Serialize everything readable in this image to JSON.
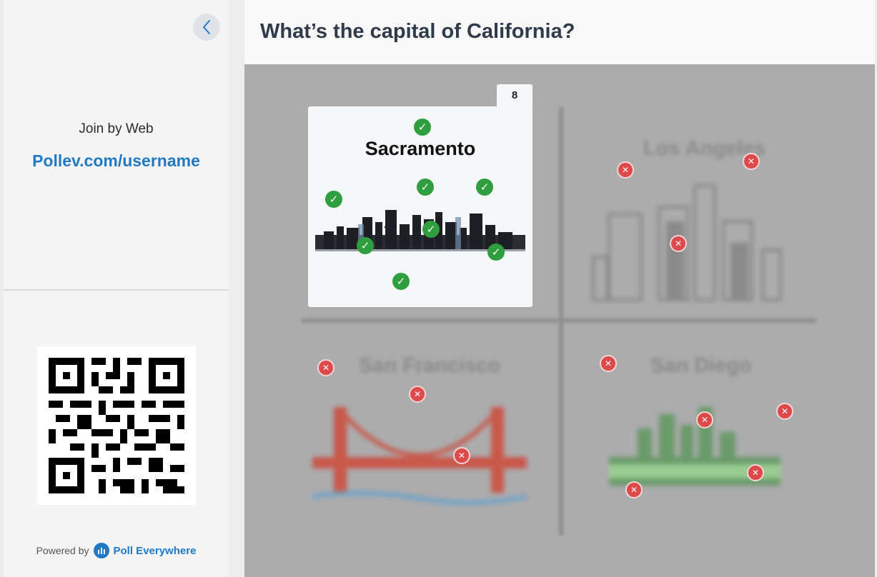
{
  "sidebar": {
    "collapse_icon": "chevron-left-icon",
    "join_label": "Join by Web",
    "join_url": "Pollev.com/username",
    "powered_by": "Powered by",
    "brand": "Poll Everywhere"
  },
  "question": {
    "title": "What’s the capital of California?"
  },
  "options": {
    "sacramento": {
      "label": "Sacramento",
      "count": "8",
      "status": "correct"
    },
    "los_angeles": {
      "label": "Los Angeles",
      "status": "wrong"
    },
    "san_francisco": {
      "label": "San Francisco",
      "status": "wrong"
    },
    "san_diego": {
      "label": "San Diego",
      "status": "wrong"
    }
  },
  "colors": {
    "accent": "#1f79c7",
    "correct": "#2e9e3e",
    "wrong": "#de4a4a",
    "heading": "#2f3a4b"
  }
}
